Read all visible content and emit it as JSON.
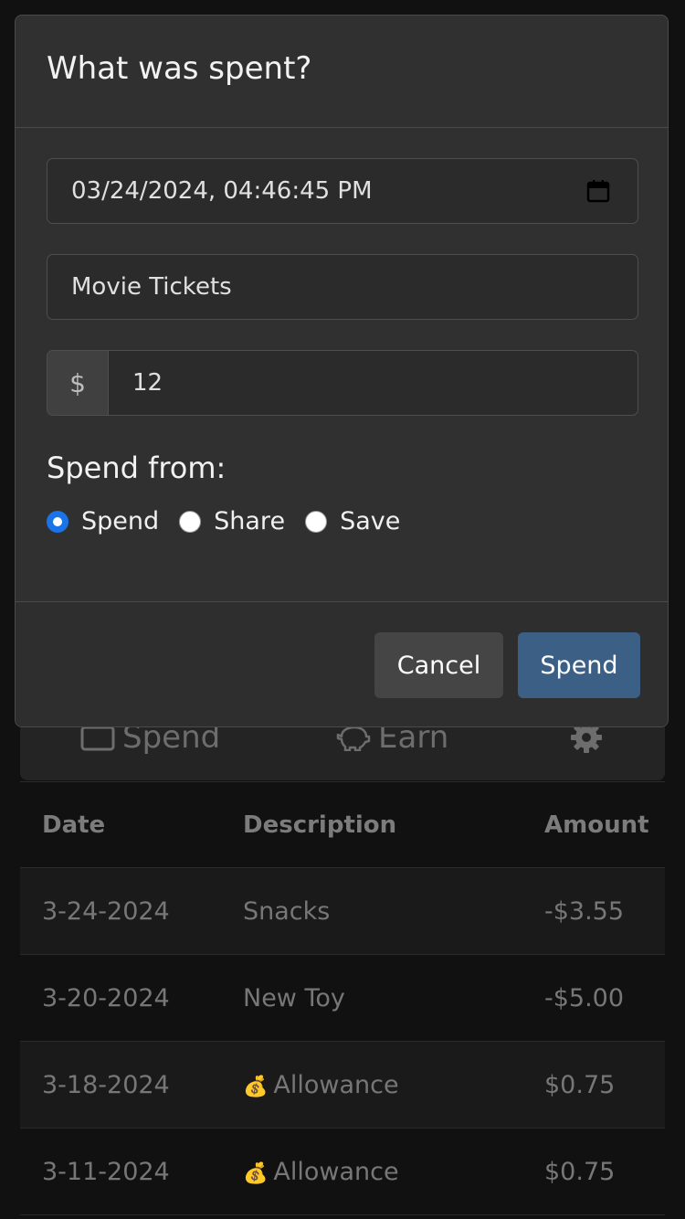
{
  "modal": {
    "title": "What was spent?",
    "date_value": "03/24/2024, 04:46:45 PM",
    "description_value": "Movie Tickets",
    "currency_symbol": "$",
    "amount_value": "12",
    "spend_from_label": "Spend from:",
    "options": [
      {
        "label": "Spend",
        "checked": true
      },
      {
        "label": "Share",
        "checked": false
      },
      {
        "label": "Save",
        "checked": false
      }
    ],
    "cancel_label": "Cancel",
    "submit_label": "Spend",
    "accent_color": "#1a73e8",
    "primary_button_color": "#3c5f86"
  },
  "tabs": {
    "spend_label": "Spend",
    "earn_label": "Earn",
    "spend_icon": "wallet-icon",
    "earn_icon": "piggy-bank-icon",
    "settings_icon": "gear-icon"
  },
  "table": {
    "headers": [
      "Date",
      "Description",
      "Amount"
    ],
    "rows": [
      {
        "date": "3-24-2024",
        "description": "Snacks",
        "amount": "-$3.55",
        "icon": ""
      },
      {
        "date": "3-20-2024",
        "description": "New Toy",
        "amount": "-$5.00",
        "icon": ""
      },
      {
        "date": "3-18-2024",
        "description": "Allowance",
        "amount": "$0.75",
        "icon": "money-bag-icon"
      },
      {
        "date": "3-11-2024",
        "description": "Allowance",
        "amount": "$0.75",
        "icon": "money-bag-icon"
      }
    ]
  }
}
